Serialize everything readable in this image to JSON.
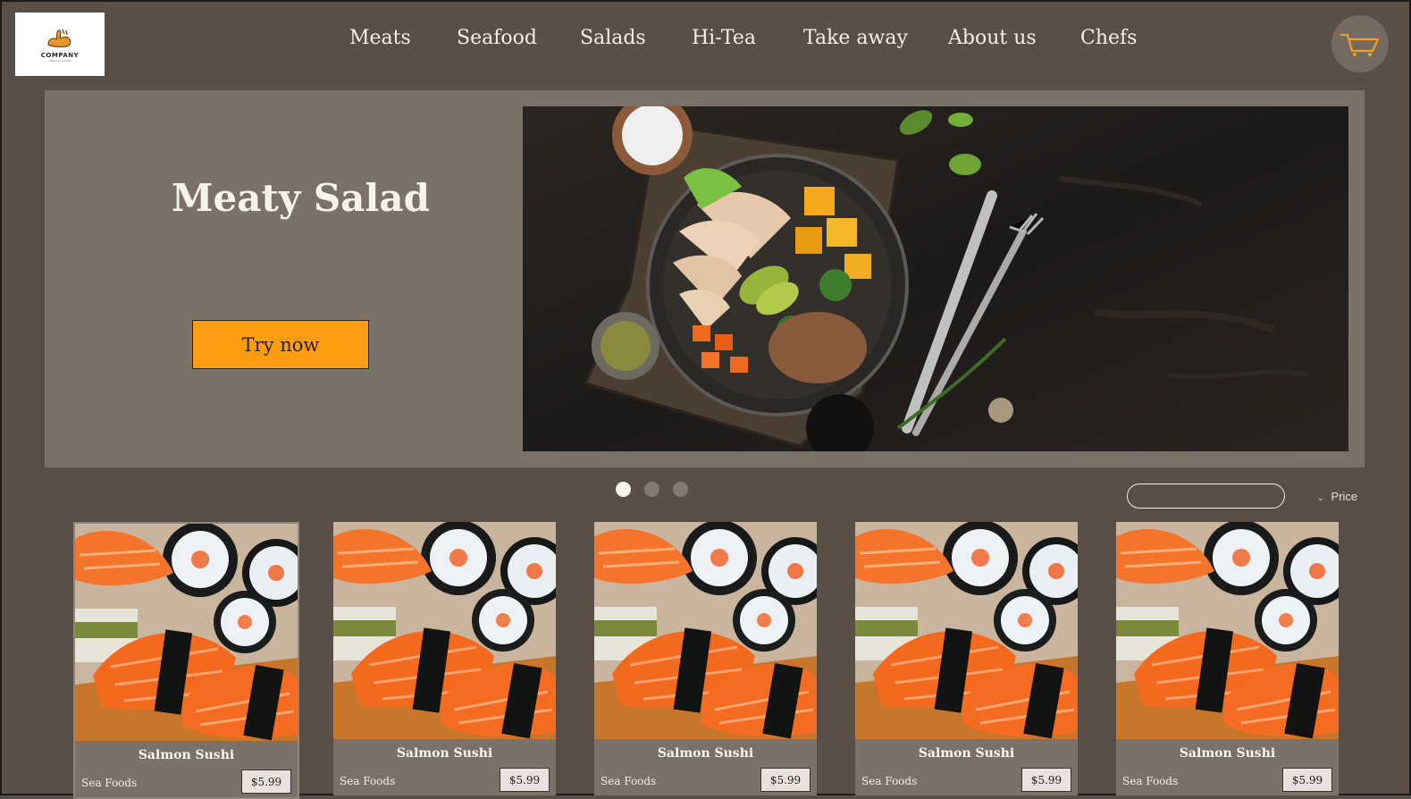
{
  "brand": {
    "logo_text": "COMPANY",
    "logo_tagline": "taste since 1990"
  },
  "nav": {
    "items": [
      "Meats",
      "Seafood",
      "Salads",
      "Hi-Tea",
      "Take away",
      "About us",
      "Chefs"
    ]
  },
  "cart": {
    "icon": "cart-icon"
  },
  "hero": {
    "title": "Meaty Salad",
    "cta_label": "Try now"
  },
  "carousel": {
    "slides": 3,
    "active": 1
  },
  "filters": {
    "search_placeholder": "",
    "sort_label": "Price"
  },
  "products": [
    {
      "name": "Salmon Sushi",
      "category": "Sea Foods",
      "price": "$5.99"
    },
    {
      "name": "Salmon Sushi",
      "category": "Sea Foods",
      "price": "$5.99"
    },
    {
      "name": "Salmon Sushi",
      "category": "Sea Foods",
      "price": "$5.99"
    },
    {
      "name": "Salmon Sushi",
      "category": "Sea Foods",
      "price": "$5.99"
    },
    {
      "name": "Salmon Sushi",
      "category": "Sea Foods",
      "price": "$5.99"
    }
  ],
  "colors": {
    "background": "#5a4f47",
    "hero_panel": "#7a7168",
    "accent": "#ff9d12",
    "cart_circle": "#756a61"
  }
}
